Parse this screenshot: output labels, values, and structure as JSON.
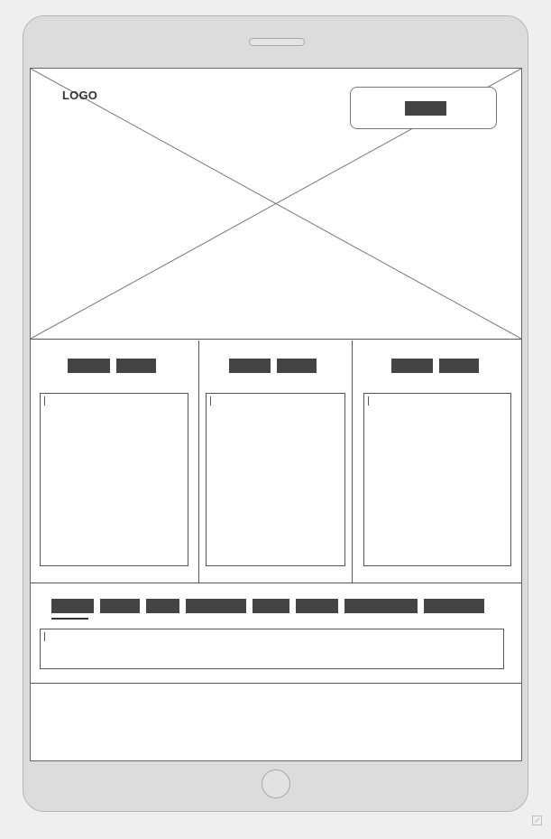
{
  "device": {
    "type": "tablet"
  },
  "hero": {
    "logo_text": "LOGO",
    "image": "placeholder-image"
  },
  "columns": [
    {
      "tabs": 2,
      "content": ""
    },
    {
      "tabs": 2,
      "content": ""
    },
    {
      "tabs": 2,
      "content": ""
    }
  ],
  "tab_bar": {
    "tab_count": 8,
    "active_index": 0,
    "content": ""
  }
}
